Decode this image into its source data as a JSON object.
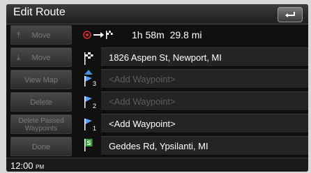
{
  "header": {
    "title": "Edit Route"
  },
  "summary": {
    "duration": "1h 58m",
    "distance": "29.8 mi"
  },
  "sidebar": {
    "move_up": "Move",
    "move_down": "Move",
    "view_map": "View Map",
    "delete": "Delete",
    "delete_passed": "Delete Passed Waypoints",
    "done": "Done"
  },
  "route": [
    {
      "label": "1826 Aspen St, Newport, MI",
      "marker": "destination-flag"
    },
    {
      "label": "<Add Waypoint>",
      "marker": "waypoint-3"
    },
    {
      "label": "<Add Waypoint>",
      "marker": "waypoint-2"
    },
    {
      "label": "<Add Waypoint>",
      "marker": "waypoint-1"
    },
    {
      "label": "Geddes Rd, Ypsilanti, MI",
      "marker": "start-flag"
    }
  ],
  "waypoint_numbers": [
    "3",
    "2",
    "1"
  ],
  "clock": {
    "time": "12:00",
    "ampm": "PM"
  }
}
